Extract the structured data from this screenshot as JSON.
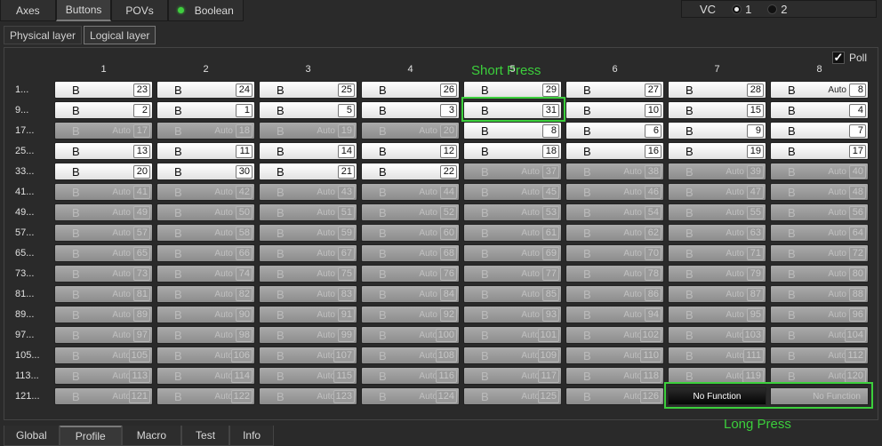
{
  "top_tabs": [
    {
      "label": "Axes",
      "active": false
    },
    {
      "label": "Buttons",
      "active": true
    },
    {
      "label": "POVs",
      "active": false
    },
    {
      "label": "Boolean",
      "active": false
    }
  ],
  "vc": {
    "label": "VC",
    "options": [
      "1",
      "2"
    ],
    "selected": "1"
  },
  "sub_tabs": [
    {
      "label": "Physical layer",
      "active": false
    },
    {
      "label": "Logical layer",
      "active": true
    }
  ],
  "poll": {
    "label": "Poll",
    "checked": true
  },
  "columns": [
    "1",
    "2",
    "3",
    "4",
    "5",
    "6",
    "7",
    "8"
  ],
  "row_labels": [
    "1...",
    "9...",
    "17...",
    "25...",
    "33...",
    "41...",
    "49...",
    "57...",
    "65...",
    "73...",
    "81...",
    "89...",
    "97...",
    "105...",
    "113...",
    "121..."
  ],
  "grid": [
    [
      {
        "on": true,
        "num": "23"
      },
      {
        "on": true,
        "num": "24"
      },
      {
        "on": true,
        "num": "25"
      },
      {
        "on": true,
        "num": "26"
      },
      {
        "on": true,
        "num": "29"
      },
      {
        "on": true,
        "num": "27"
      },
      {
        "on": true,
        "num": "28"
      },
      {
        "on": true,
        "num": "8",
        "auto": true,
        "noB": true
      }
    ],
    [
      {
        "on": true,
        "num": "2"
      },
      {
        "on": true,
        "num": "1"
      },
      {
        "on": true,
        "num": "5"
      },
      {
        "on": true,
        "num": "3"
      },
      {
        "on": true,
        "num": "31"
      },
      {
        "on": true,
        "num": "10"
      },
      {
        "on": true,
        "num": "15"
      },
      {
        "on": true,
        "num": "4"
      }
    ],
    [
      {
        "on": false,
        "num": "17"
      },
      {
        "on": false,
        "num": "18"
      },
      {
        "on": false,
        "num": "19"
      },
      {
        "on": false,
        "num": "20"
      },
      {
        "on": true,
        "num": "8"
      },
      {
        "on": true,
        "num": "6"
      },
      {
        "on": true,
        "num": "9"
      },
      {
        "on": true,
        "num": "7"
      }
    ],
    [
      {
        "on": true,
        "num": "13"
      },
      {
        "on": true,
        "num": "11"
      },
      {
        "on": true,
        "num": "14"
      },
      {
        "on": true,
        "num": "12"
      },
      {
        "on": true,
        "num": "18"
      },
      {
        "on": true,
        "num": "16"
      },
      {
        "on": true,
        "num": "19"
      },
      {
        "on": true,
        "num": "17"
      }
    ],
    [
      {
        "on": true,
        "num": "20"
      },
      {
        "on": true,
        "num": "30"
      },
      {
        "on": true,
        "num": "21"
      },
      {
        "on": true,
        "num": "22"
      },
      {
        "on": false,
        "num": "37"
      },
      {
        "on": false,
        "num": "38"
      },
      {
        "on": false,
        "num": "39"
      },
      {
        "on": false,
        "num": "40"
      }
    ],
    [
      {
        "on": false,
        "num": "41"
      },
      {
        "on": false,
        "num": "42"
      },
      {
        "on": false,
        "num": "43"
      },
      {
        "on": false,
        "num": "44"
      },
      {
        "on": false,
        "num": "45"
      },
      {
        "on": false,
        "num": "46"
      },
      {
        "on": false,
        "num": "47"
      },
      {
        "on": false,
        "num": "48"
      }
    ],
    [
      {
        "on": false,
        "num": "49"
      },
      {
        "on": false,
        "num": "50"
      },
      {
        "on": false,
        "num": "51"
      },
      {
        "on": false,
        "num": "52"
      },
      {
        "on": false,
        "num": "53"
      },
      {
        "on": false,
        "num": "54"
      },
      {
        "on": false,
        "num": "55"
      },
      {
        "on": false,
        "num": "56"
      }
    ],
    [
      {
        "on": false,
        "num": "57"
      },
      {
        "on": false,
        "num": "58"
      },
      {
        "on": false,
        "num": "59"
      },
      {
        "on": false,
        "num": "60"
      },
      {
        "on": false,
        "num": "61"
      },
      {
        "on": false,
        "num": "62"
      },
      {
        "on": false,
        "num": "63"
      },
      {
        "on": false,
        "num": "64"
      }
    ],
    [
      {
        "on": false,
        "num": "65"
      },
      {
        "on": false,
        "num": "66"
      },
      {
        "on": false,
        "num": "67"
      },
      {
        "on": false,
        "num": "68"
      },
      {
        "on": false,
        "num": "69"
      },
      {
        "on": false,
        "num": "70"
      },
      {
        "on": false,
        "num": "71"
      },
      {
        "on": false,
        "num": "72"
      }
    ],
    [
      {
        "on": false,
        "num": "73"
      },
      {
        "on": false,
        "num": "74"
      },
      {
        "on": false,
        "num": "75"
      },
      {
        "on": false,
        "num": "76"
      },
      {
        "on": false,
        "num": "77"
      },
      {
        "on": false,
        "num": "78"
      },
      {
        "on": false,
        "num": "79"
      },
      {
        "on": false,
        "num": "80"
      }
    ],
    [
      {
        "on": false,
        "num": "81"
      },
      {
        "on": false,
        "num": "82"
      },
      {
        "on": false,
        "num": "83"
      },
      {
        "on": false,
        "num": "84"
      },
      {
        "on": false,
        "num": "85"
      },
      {
        "on": false,
        "num": "86"
      },
      {
        "on": false,
        "num": "87"
      },
      {
        "on": false,
        "num": "88"
      }
    ],
    [
      {
        "on": false,
        "num": "89"
      },
      {
        "on": false,
        "num": "90"
      },
      {
        "on": false,
        "num": "91"
      },
      {
        "on": false,
        "num": "92"
      },
      {
        "on": false,
        "num": "93"
      },
      {
        "on": false,
        "num": "94"
      },
      {
        "on": false,
        "num": "95"
      },
      {
        "on": false,
        "num": "96"
      }
    ],
    [
      {
        "on": false,
        "num": "97"
      },
      {
        "on": false,
        "num": "98"
      },
      {
        "on": false,
        "num": "99"
      },
      {
        "on": false,
        "num": "100"
      },
      {
        "on": false,
        "num": "101"
      },
      {
        "on": false,
        "num": "102"
      },
      {
        "on": false,
        "num": "103"
      },
      {
        "on": false,
        "num": "104"
      }
    ],
    [
      {
        "on": false,
        "num": "105"
      },
      {
        "on": false,
        "num": "106"
      },
      {
        "on": false,
        "num": "107"
      },
      {
        "on": false,
        "num": "108"
      },
      {
        "on": false,
        "num": "109"
      },
      {
        "on": false,
        "num": "110"
      },
      {
        "on": false,
        "num": "111"
      },
      {
        "on": false,
        "num": "112"
      }
    ],
    [
      {
        "on": false,
        "num": "113"
      },
      {
        "on": false,
        "num": "114"
      },
      {
        "on": false,
        "num": "115"
      },
      {
        "on": false,
        "num": "116"
      },
      {
        "on": false,
        "num": "117"
      },
      {
        "on": false,
        "num": "118"
      },
      {
        "on": false,
        "num": "119"
      },
      {
        "on": false,
        "num": "120"
      }
    ],
    [
      {
        "on": false,
        "num": "121"
      },
      {
        "on": false,
        "num": "122"
      },
      {
        "on": false,
        "num": "123"
      },
      {
        "on": false,
        "num": "124"
      },
      {
        "on": false,
        "num": "125"
      },
      {
        "on": false,
        "num": "126"
      },
      {
        "nofunc": "dark"
      },
      {
        "nofunc": "light"
      }
    ]
  ],
  "cell_b_label": "B",
  "auto_label": "Auto",
  "no_function_label": "No Function",
  "annotations": {
    "short_press": "Short Press",
    "long_press": "Long Press"
  },
  "bottom_tabs": [
    {
      "label": "Global",
      "active": false
    },
    {
      "label": "Profile",
      "active": true
    },
    {
      "label": "Macro",
      "active": false
    },
    {
      "label": "Test",
      "active": false
    },
    {
      "label": "Info",
      "active": false
    }
  ],
  "colors": {
    "highlight": "#3ccf3c",
    "led": "#3fcf3f"
  }
}
